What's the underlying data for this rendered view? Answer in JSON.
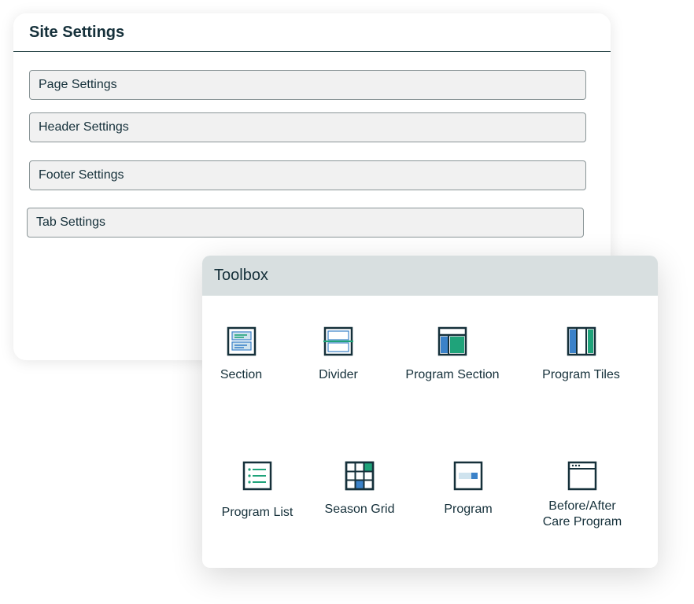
{
  "site_settings": {
    "title": "Site Settings",
    "items": [
      {
        "label": "Page Settings"
      },
      {
        "label": "Header Settings"
      },
      {
        "label": "Footer Settings"
      },
      {
        "label": "Tab Settings"
      }
    ]
  },
  "toolbox": {
    "title": "Toolbox",
    "tools": [
      {
        "label": "Section",
        "icon": "section-icon"
      },
      {
        "label": "Divider",
        "icon": "divider-icon"
      },
      {
        "label": "Program Section",
        "icon": "program-section-icon"
      },
      {
        "label": "Program Tiles",
        "icon": "program-tiles-icon"
      },
      {
        "label": "Program List",
        "icon": "program-list-icon"
      },
      {
        "label": "Season Grid",
        "icon": "season-grid-icon"
      },
      {
        "label": "Program",
        "icon": "program-icon"
      },
      {
        "label": "Before/After\nCare Program",
        "icon": "before-after-care-icon"
      }
    ]
  },
  "colors": {
    "ink": "#15303a",
    "green": "#1fa37a",
    "blue": "#3b82c9",
    "light_blue": "#cfe3ee",
    "header_gray": "#d8dfe0"
  }
}
